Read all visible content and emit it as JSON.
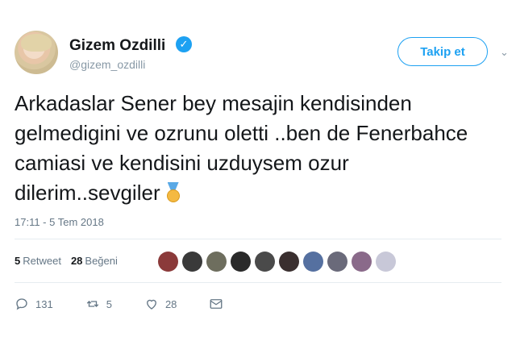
{
  "user": {
    "name": "Gizem Ozdilli",
    "handle": "@gizem_ozdilli",
    "verified_glyph": "✓"
  },
  "follow_button": {
    "label": "Takip et"
  },
  "caret_glyph": "⌄",
  "tweet": {
    "text": "Arkadaslar Sener bey mesajin kendisinden gelmedigini ve ozrunu oletti ..ben de Fenerbahce camiasi ve kendisini uzduysem ozur dilerim..sevgiler",
    "emoji_icon": "medal-icon",
    "timestamp": "17:11 - 5 Tem 2018"
  },
  "stats": {
    "retweets_count": "5",
    "retweets_label": "Retweet",
    "likes_count": "28",
    "likes_label": "Beğeni"
  },
  "liker_avatars": [
    "#8b3a3a",
    "#3a3a3a",
    "#6e6e5e",
    "#2a2a2a",
    "#4a4a4a",
    "#3a2f2f",
    "#5570a0",
    "#6a6a7a",
    "#8a6a8a",
    "#c8c8d8"
  ],
  "actions": {
    "replies": "131",
    "retweets": "5",
    "likes": "28"
  },
  "colors": {
    "accent": "#1da1f2",
    "muted": "#657786"
  }
}
